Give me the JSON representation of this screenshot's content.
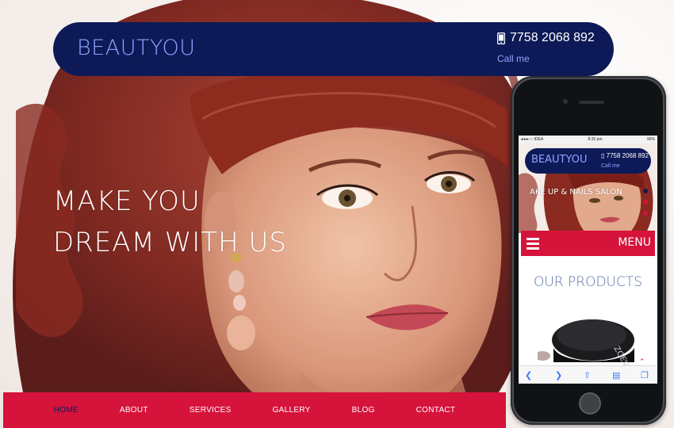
{
  "header": {
    "brand": "BEAUTYOU",
    "phone_number": "7758 2068 892",
    "call_label": "Call me"
  },
  "hero": {
    "tagline_line1": "MAKE YOU",
    "tagline_line2": "DREAM WITH US"
  },
  "nav": {
    "items": [
      {
        "label": "HOME",
        "active": true
      },
      {
        "label": "ABOUT",
        "active": false
      },
      {
        "label": "SERVICES",
        "active": false
      },
      {
        "label": "GALLERY",
        "active": false
      },
      {
        "label": "BLOG",
        "active": false
      },
      {
        "label": "CONTACT",
        "active": false
      }
    ]
  },
  "mobile": {
    "status_carrier": "●●●○○ IDEA",
    "status_time": "8:20 pm",
    "status_battery": "90%",
    "brand": "BEAUTYOU",
    "phone_number": "7758 2068 892",
    "call_label": "Call me",
    "salon_caption": "AKE UP & NAILS SALON",
    "menu_label": "MENU",
    "section_title": "OUR PRODUCTS",
    "product_brand": "ZOEVA"
  },
  "colors": {
    "navy": "#0d1a57",
    "accent_red": "#d6133b",
    "brand_blue": "#8fa3ff"
  },
  "icons": [
    "phone-icon",
    "hamburger-icon",
    "back-arrow-icon",
    "forward-arrow-icon",
    "share-icon",
    "bookmarks-icon",
    "tabs-icon",
    "scroll-up-icon"
  ]
}
